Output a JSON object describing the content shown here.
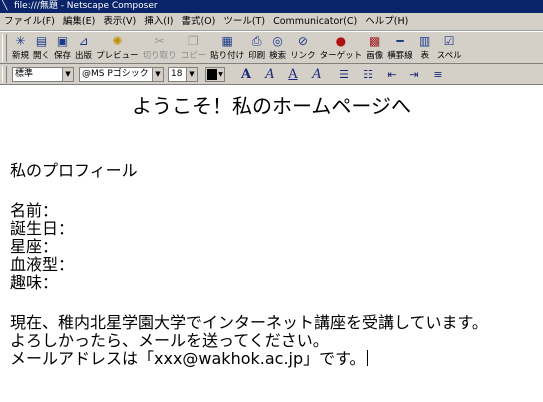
{
  "window": {
    "title": "file:///無題 - Netscape Composer"
  },
  "menu": {
    "items": [
      "ファイル(F)",
      "編集(E)",
      "表示(V)",
      "挿入(I)",
      "書式(O)",
      "ツール(T)",
      "Communicator(C)",
      "ヘルプ(H)"
    ]
  },
  "toolbar": {
    "buttons": [
      {
        "label": "新規",
        "icon": "new-page-icon"
      },
      {
        "label": "開く",
        "icon": "open-icon"
      },
      {
        "label": "保存",
        "icon": "save-icon"
      },
      {
        "label": "出版",
        "icon": "publish-icon"
      },
      {
        "label": "プレビュー",
        "icon": "preview-icon"
      },
      {
        "label": "切り取り",
        "icon": "cut-icon",
        "disabled": true
      },
      {
        "label": "コピー",
        "icon": "copy-icon",
        "disabled": true
      },
      {
        "label": "貼り付け",
        "icon": "paste-icon"
      },
      {
        "label": "印刷",
        "icon": "print-icon"
      },
      {
        "label": "検索",
        "icon": "find-icon"
      },
      {
        "label": "リンク",
        "icon": "link-icon"
      },
      {
        "label": "ターゲット",
        "icon": "target-icon"
      },
      {
        "label": "画像",
        "icon": "image-icon"
      },
      {
        "label": "横罫線",
        "icon": "horizontal-line-icon"
      },
      {
        "label": "表",
        "icon": "table-icon"
      },
      {
        "label": "スペル",
        "icon": "spell-check-icon"
      }
    ]
  },
  "format": {
    "paragraph_style": "標準",
    "font": "@MS Pゴシック",
    "size": "18",
    "text_color": "#000000"
  },
  "document": {
    "heading": "ようこそ！私のホームページへ",
    "profile_title": "私のプロフィール",
    "fields": [
      "名前：",
      "誕生日：",
      "星座：",
      "血液型：",
      "趣味："
    ],
    "body": [
      "現在、稚内北星学園大学でインターネット講座を受講しています。",
      "よろしかったら、メールを送ってください。",
      "メールアドレスは「xxx@wakhok.ac.jp」です。"
    ]
  }
}
